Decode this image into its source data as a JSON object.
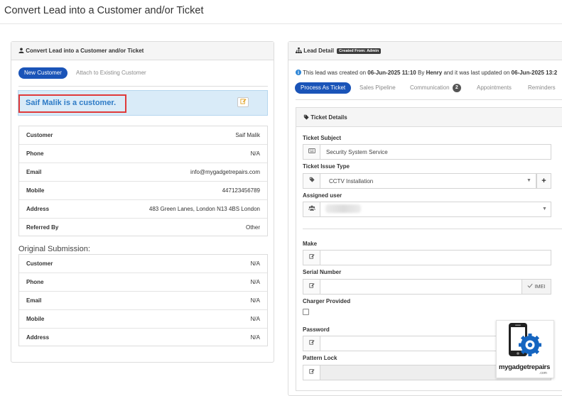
{
  "page": {
    "title": "Convert Lead into a Customer and/or Ticket"
  },
  "left_panel": {
    "heading": "Convert Lead into a Customer and/or Ticket",
    "tabs": [
      {
        "label": "New Customer",
        "active": true
      },
      {
        "label": "Attach to Existing Customer",
        "active": false
      }
    ],
    "customer_status": "Saif Malik is a customer.",
    "customer_details": [
      {
        "key": "Customer",
        "value": "Saif Malik"
      },
      {
        "key": "Phone",
        "value": "N/A"
      },
      {
        "key": "Email",
        "value": "info@mygadgetrepairs.com"
      },
      {
        "key": "Mobile",
        "value": "447123456789"
      },
      {
        "key": "Address",
        "value": "483 Green Lanes, London N13 4BS London"
      },
      {
        "key": "Referred By",
        "value": "Other"
      }
    ],
    "original_submission_label": "Original Submission:",
    "original_submission": [
      {
        "key": "Customer",
        "value": "N/A"
      },
      {
        "key": "Phone",
        "value": "N/A"
      },
      {
        "key": "Email",
        "value": "N/A"
      },
      {
        "key": "Mobile",
        "value": "N/A"
      },
      {
        "key": "Address",
        "value": "N/A"
      }
    ]
  },
  "right_panel": {
    "heading": "Lead Detail",
    "created_badge": "Created From: Admin",
    "info": {
      "prefix": "This lead was created on",
      "created_date": "06-Jun-2025 11:10",
      "by_word": "By",
      "user": "Henry",
      "middle": "and it was last updated on",
      "updated_date": "06-Jun-2025 13:2"
    },
    "tabs": [
      {
        "label": "Process As Ticket",
        "active": true
      },
      {
        "label": "Sales Pipeline",
        "active": false
      },
      {
        "label": "Communication",
        "active": false,
        "count": "2"
      },
      {
        "label": "Appointments",
        "active": false
      },
      {
        "label": "Reminders",
        "active": false
      }
    ],
    "ticket": {
      "heading": "Ticket Details",
      "subject_label": "Ticket Subject",
      "subject_value": "Security System Service",
      "issue_type_label": "Ticket Issue Type",
      "issue_type_value": "CCTV Installation",
      "assigned_label": "Assigned user",
      "make_label": "Make",
      "make_value": "",
      "serial_label": "Serial Number",
      "serial_value": "",
      "imei_label": "IMEI",
      "charger_label": "Charger Provided",
      "charger_checked": false,
      "password_label": "Password",
      "password_value": "",
      "pattern_label": "Pattern Lock"
    }
  },
  "logo": {
    "name": "mygadgetrepairs",
    "suffix": ".com",
    "brand_color": "#1565c0"
  },
  "colors": {
    "primary": "#1a54b8",
    "highlight_border": "#e03a3a",
    "banner_bg": "#d9ebf8",
    "link_text": "#2e7bc6"
  }
}
